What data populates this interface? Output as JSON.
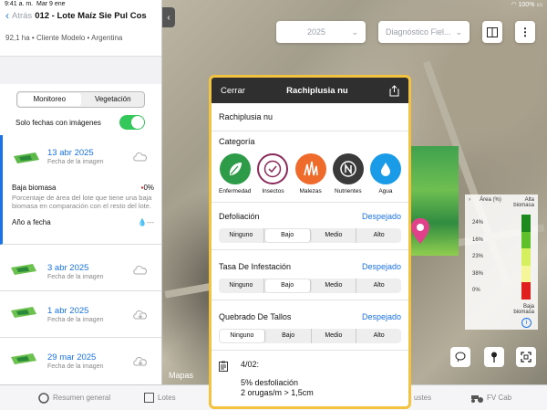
{
  "status_bar": {
    "time": "9:41 a. m.",
    "date": "Mar 9 ene",
    "battery": "100%"
  },
  "header": {
    "back_label": "Atrás",
    "title": "012 - Lote Maíz Sie Pul Cos",
    "subtitle": "92,1 ha • Cliente Modelo • Argentina"
  },
  "segment": {
    "options": [
      "Monitoreo",
      "Vegetación"
    ],
    "selected": "Monitoreo"
  },
  "filter": {
    "label": "Solo fechas con imágenes",
    "enabled": true
  },
  "images": [
    {
      "date": "13 abr 2025",
      "label": "Fecha de la imagen",
      "selected": true
    },
    {
      "date": "3 abr 2025",
      "label": "Fecha de la imagen"
    },
    {
      "date": "1 abr 2025",
      "label": "Fecha de la imagen"
    },
    {
      "date": "29 mar 2025",
      "label": "Fecha de la imagen"
    }
  ],
  "biomass": {
    "label": "Baja biomasa",
    "value": "0%",
    "description": "Porcentaje de área del lote que tiene una baja biomasa en comparación con el resto del lote.",
    "year_label": "Año a fecha",
    "year_value": "---"
  },
  "map": {
    "year": "2025",
    "diagnostic": "Diagnóstico Fiel...",
    "maps_label": "Mapas",
    "legend": {
      "area_label": "Área (%)",
      "high_label": "Alta biomasa",
      "low_label": "Baja biomasa",
      "rows": [
        {
          "pct": "24%",
          "color": "#1e8a1e"
        },
        {
          "pct": "16%",
          "color": "#5fc02c"
        },
        {
          "pct": "23%",
          "color": "#d6ef5e"
        },
        {
          "pct": "38%",
          "color": "#f5f59a"
        },
        {
          "pct": "0%",
          "color": "#e0201e"
        }
      ]
    }
  },
  "modal": {
    "close_label": "Cerrar",
    "title": "Rachiplusia nu",
    "pest_name": "Rachiplusia nu",
    "category_label": "Categoría",
    "categories": [
      {
        "label": "Enfermedad",
        "color": "#2e9b48",
        "icon": "leaf-icon"
      },
      {
        "label": "Insectos",
        "color": "#ffffff",
        "icon": "check-circle-icon"
      },
      {
        "label": "Malezas",
        "color": "#ef6b2b",
        "icon": "grass-icon"
      },
      {
        "label": "Nutrientes",
        "color": "#3a3a3a",
        "icon": "nutrient-n-icon"
      },
      {
        "label": "Agua",
        "color": "#1a9be8",
        "icon": "water-drop-icon"
      }
    ],
    "questions": [
      {
        "label": "Defoliación",
        "value": "Despejado",
        "options": [
          "Ninguno",
          "Bajo",
          "Medio",
          "Alto"
        ],
        "selected": 1
      },
      {
        "label": "Tasa De Infestación",
        "value": "Despejado",
        "options": [
          "Ninguno",
          "Bajo",
          "Medio",
          "Alto"
        ],
        "selected": 1
      },
      {
        "label": "Quebrado De Tallos",
        "value": "Despejado",
        "options": [
          "Ninguno",
          "Bajo",
          "Medio",
          "Alto"
        ],
        "selected": 0
      }
    ],
    "note": {
      "date": "4/02:",
      "line1": "5% desfoliación",
      "line2": "2 orugas/m > 1,5cm"
    }
  },
  "tabbar": {
    "summary": "Resumen general",
    "lots": "Lotes",
    "adjust": "ustes",
    "fv": "FV Cab"
  },
  "colors": {
    "accent": "#1a73e8",
    "highlight": "#f3c23e",
    "toggle": "#34c759"
  }
}
